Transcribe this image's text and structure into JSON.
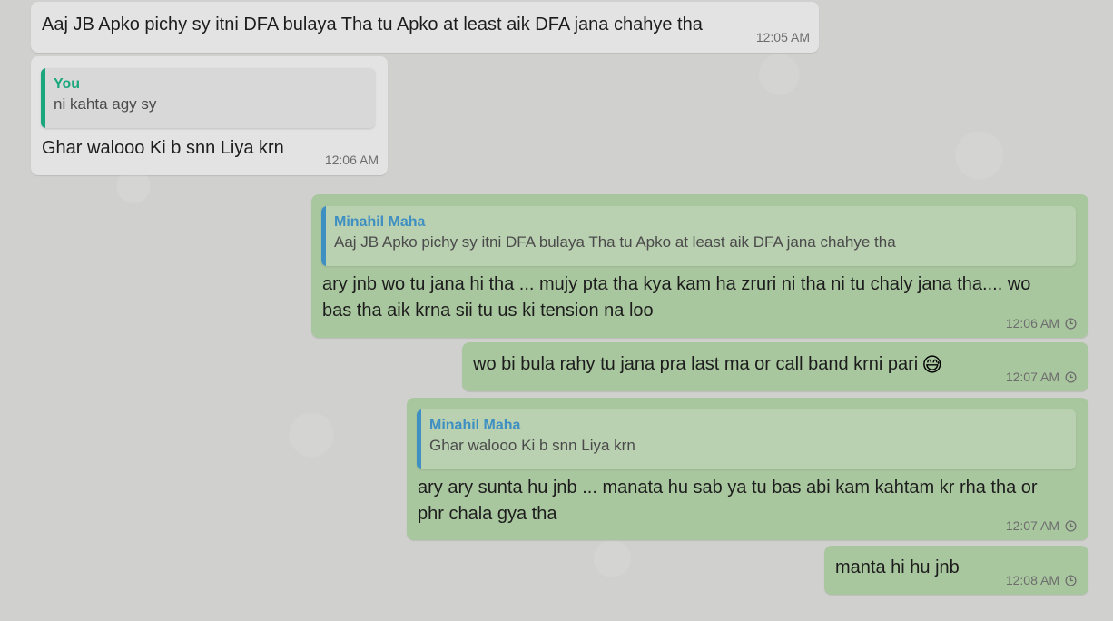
{
  "colors": {
    "incoming_bubble": "#e3e3e3",
    "outgoing_bubble": "#a9c79f",
    "you_quote_accent": "#1aa77e",
    "contact_quote_accent": "#3e8fc2"
  },
  "messages": [
    {
      "direction": "incoming",
      "text": "Aaj JB Apko pichy sy itni DFA bulaya Tha tu Apko at least aik DFA jana chahye tha",
      "time": "12:05 AM"
    },
    {
      "direction": "incoming",
      "quote": {
        "author": "You",
        "text": "ni kahta agy sy"
      },
      "text": "Ghar walooo Ki b snn Liya krn",
      "time": "12:06 AM"
    },
    {
      "direction": "outgoing",
      "quote": {
        "author": "Minahil Maha",
        "text": "Aaj JB Apko pichy sy itni DFA bulaya Tha tu Apko at least aik DFA jana chahye tha"
      },
      "text_line1": "ary jnb wo tu jana hi tha ... mujy pta tha kya kam ha zruri ni tha ni tu chaly jana tha.... wo",
      "text_line2": "bas tha aik krna sii tu us ki tension na loo",
      "time": "12:06 AM",
      "status_icon": "clock-icon"
    },
    {
      "direction": "outgoing",
      "text": "wo bi bula rahy tu jana pra last ma or call band krni pari",
      "emoji": "😅",
      "time": "12:07 AM",
      "status_icon": "clock-icon"
    },
    {
      "direction": "outgoing",
      "quote": {
        "author": "Minahil Maha",
        "text": "Ghar walooo Ki b snn Liya krn"
      },
      "text_line1": "ary ary sunta hu jnb ... manata hu sab ya tu bas abi kam kahtam kr rha tha or",
      "text_line2": "phr chala gya tha",
      "time": "12:07 AM",
      "status_icon": "clock-icon"
    },
    {
      "direction": "outgoing",
      "text": "manta hi hu jnb",
      "time": "12:08 AM",
      "status_icon": "clock-icon"
    }
  ]
}
